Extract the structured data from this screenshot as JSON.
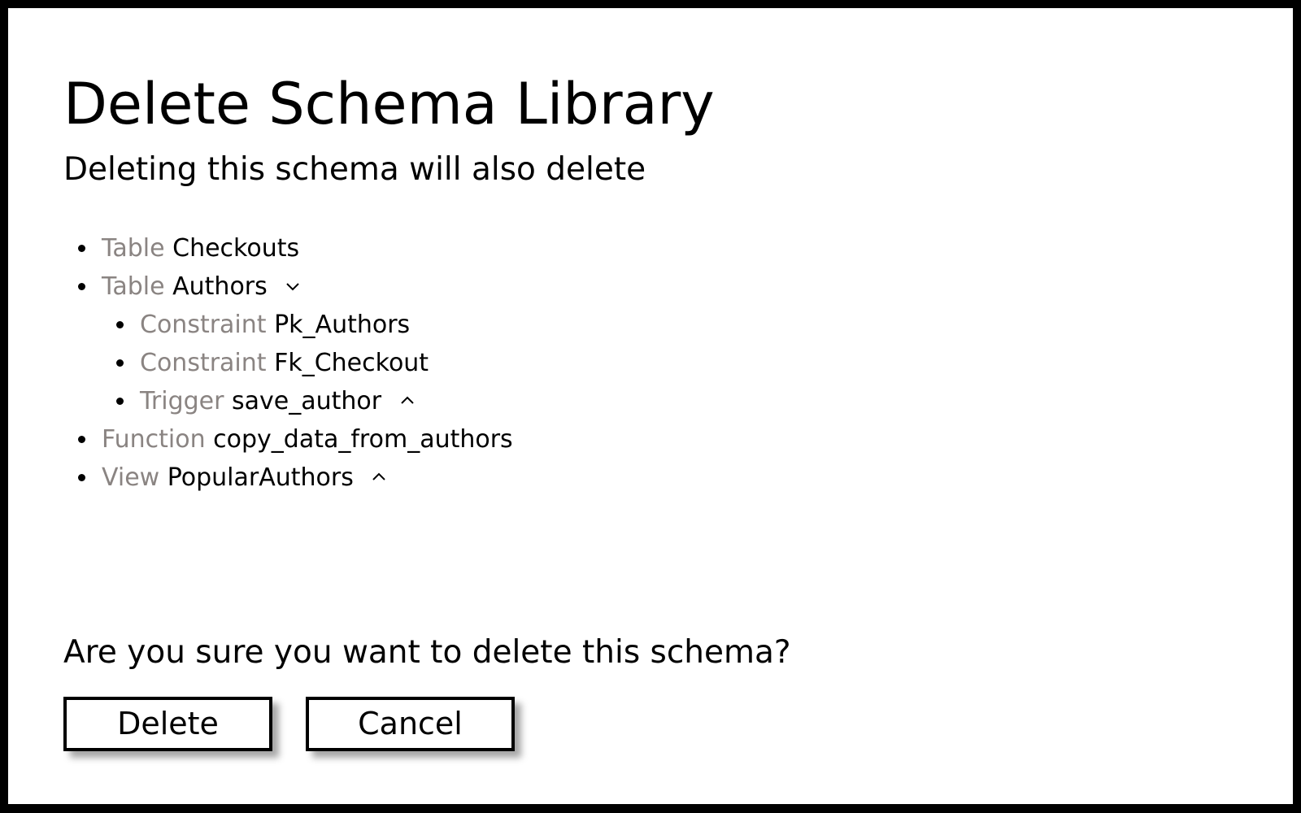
{
  "dialog": {
    "title": "Delete Schema Library",
    "subtitle": "Deleting this schema will also delete",
    "question": "Are you sure you want to delete this schema?"
  },
  "items": [
    {
      "kind": "Table",
      "name": "Checkouts",
      "level": 0,
      "toggle": "none"
    },
    {
      "kind": "Table",
      "name": "Authors",
      "level": 0,
      "toggle": "chevron-down-icon"
    },
    {
      "kind": "Constraint",
      "name": "Pk_Authors",
      "level": 1,
      "toggle": "none"
    },
    {
      "kind": "Constraint",
      "name": "Fk_Checkout",
      "level": 1,
      "toggle": "none"
    },
    {
      "kind": "Trigger",
      "name": "save_author",
      "level": 1,
      "toggle": "chevron-up-icon"
    },
    {
      "kind": "Function",
      "name": "copy_data_from_authors",
      "level": 0,
      "toggle": "none"
    },
    {
      "kind": "View",
      "name": "PopularAuthors",
      "level": 0,
      "toggle": "chevron-up-icon"
    }
  ],
  "buttons": {
    "delete_label": "Delete",
    "cancel_label": "Cancel"
  },
  "colors": {
    "kind_text": "#8a8482",
    "frame": "#000000",
    "background": "#ffffff"
  }
}
